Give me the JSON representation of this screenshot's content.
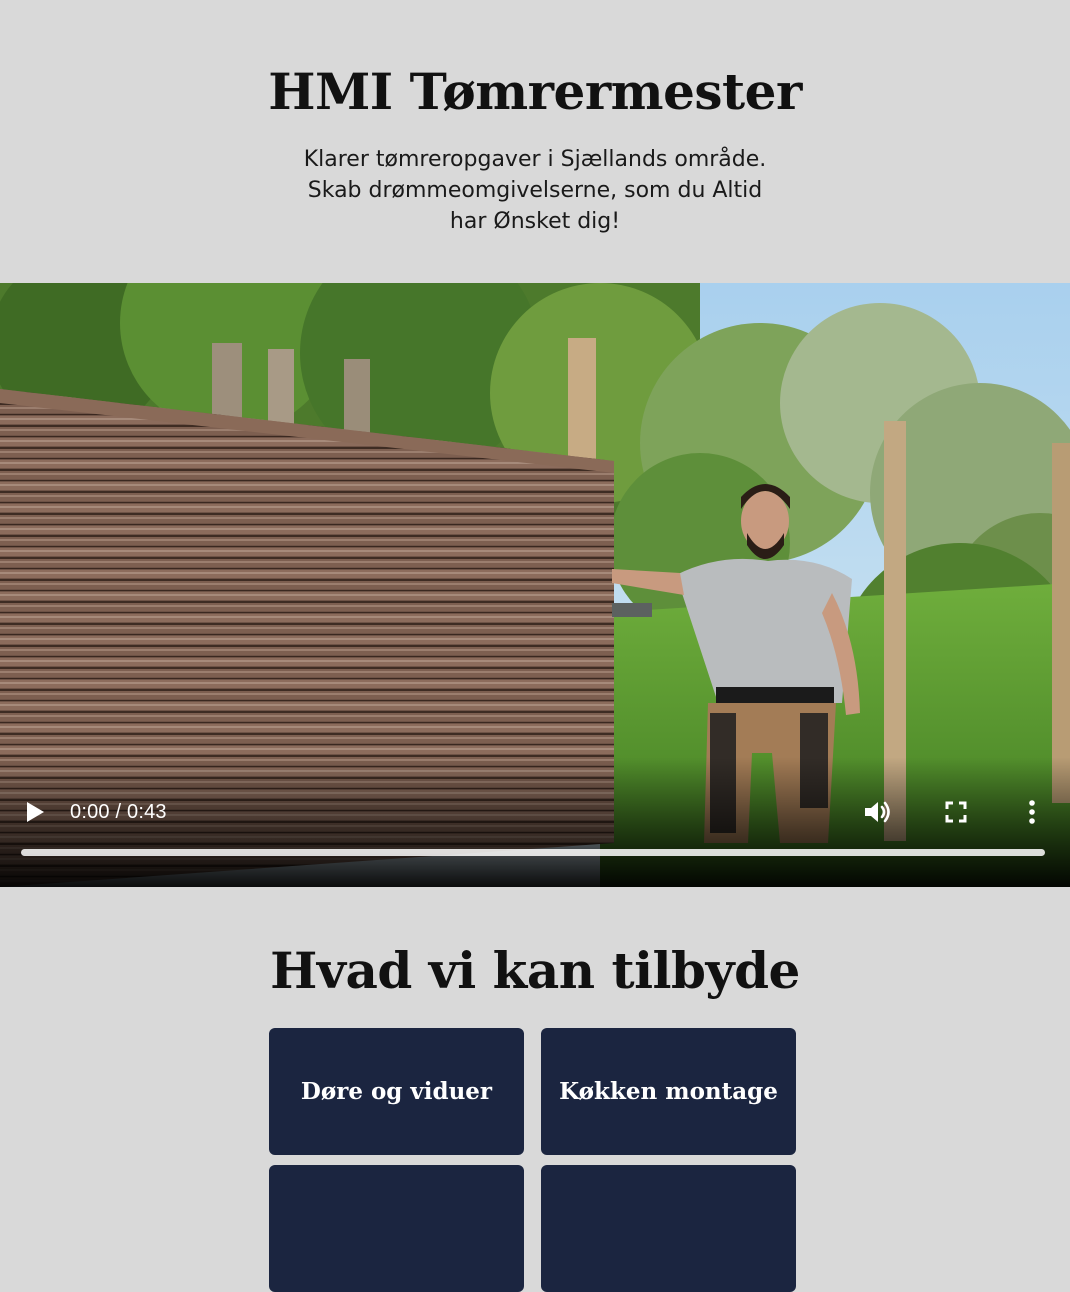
{
  "header": {
    "title": "HMI Tømrermester",
    "subtitle": "Klarer tømreropgaver i Sjællands område. Skab drømmeomgivelserne, som du Altid har Ønsket dig!"
  },
  "video": {
    "time_display": "0:00 / 0:43",
    "progress_fraction": 0,
    "controls": {
      "play": "play-icon",
      "volume": "volume-icon",
      "fullscreen": "fullscreen-icon",
      "more": "more-vertical-icon"
    }
  },
  "services": {
    "title": "Hvad vi kan tilbyde",
    "items": [
      {
        "label": "Døre og viduer"
      },
      {
        "label": "Køkken montage"
      },
      {
        "label": ""
      },
      {
        "label": ""
      }
    ]
  },
  "colors": {
    "background": "#d9d9d9",
    "card": "#1b2540",
    "text": "#111111"
  }
}
